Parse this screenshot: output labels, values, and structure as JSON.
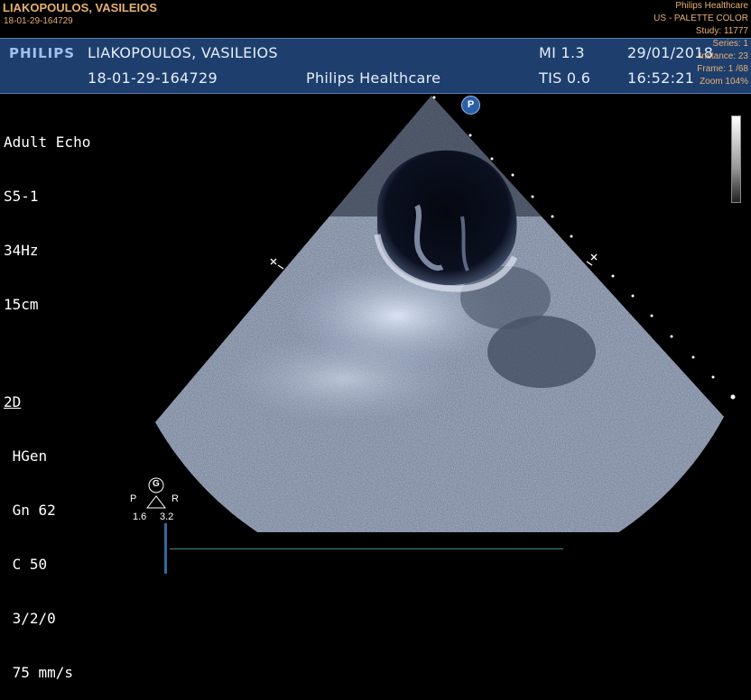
{
  "overlay": {
    "patient_name": "LIAKOPOULOS, VASILEIOS",
    "patient_id": "18-01-29-164729",
    "institution": "Philips Healthcare",
    "modality": "US - PALETTE COLOR",
    "study": "Study: 11777",
    "series": "Series: 1",
    "instance": "Instance: 23",
    "frame": "Frame: 1 /68",
    "zoom": "Zoom 104%"
  },
  "header": {
    "logo": "PHILIPS",
    "patient_name": "LIAKOPOULOS, VASILEIOS",
    "patient_id": "18-01-29-164729",
    "institution": "Philips Healthcare",
    "mi": "MI 1.3",
    "tis": "TIS 0.6",
    "date": "29/01/2018",
    "time": "16:52:21"
  },
  "params": {
    "preset": "Adult Echo",
    "probe": "S5-1",
    "frame_rate": "34Hz",
    "depth": "15cm",
    "mode": "2D",
    "gen": " HGen",
    "gain": " Gn 62",
    "compress": " C 50",
    "persist": " 3/2/0",
    "sweep": " 75 mm/s"
  },
  "marker": {
    "p_label": "P"
  },
  "orientation": {
    "g_label": "G",
    "left": "P",
    "right": "R",
    "left_val": "1.6",
    "right_val": "3.2"
  },
  "colors": {
    "header_bg": "#1e3f6e",
    "overlay_text": "#e8b070",
    "logo": "#9fc0f0"
  }
}
